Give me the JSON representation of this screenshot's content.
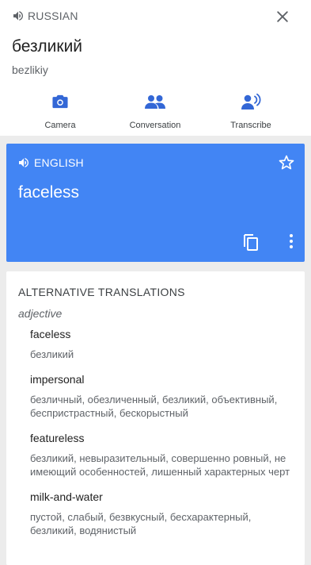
{
  "source": {
    "language": "RUSSIAN",
    "text": "безликий",
    "transliteration": "bezlikiy"
  },
  "tools": [
    {
      "label": "Camera",
      "icon": "camera-icon"
    },
    {
      "label": "Conversation",
      "icon": "conversation-icon"
    },
    {
      "label": "Transcribe",
      "icon": "transcribe-icon"
    }
  ],
  "result": {
    "language": "ENGLISH",
    "text": "faceless",
    "color": "#4285f4"
  },
  "alternatives": {
    "title": "ALTERNATIVE TRANSLATIONS",
    "part_of_speech": "adjective",
    "entries": [
      {
        "word": "faceless",
        "synonyms": "безликий"
      },
      {
        "word": "impersonal",
        "synonyms": "безличный, обезличенный, безликий, объективный, беспристрастный, бескорыстный"
      },
      {
        "word": "featureless",
        "synonyms": "безликий, невыразительный, совершенно ровный, не имеющий особенностей, лишенный характерных черт"
      },
      {
        "word": "milk-and-water",
        "synonyms": "пустой, слабый, безвкусный, бесхарактерный, безликий, водянистый"
      }
    ]
  }
}
